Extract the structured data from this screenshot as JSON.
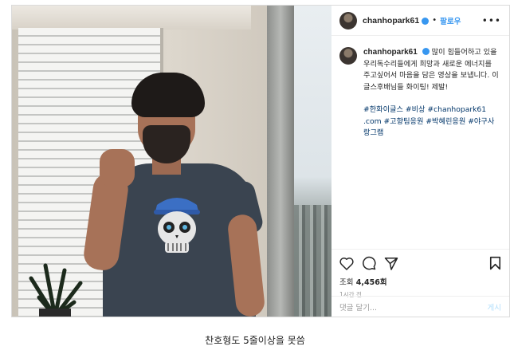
{
  "post": {
    "username": "chanhopark61",
    "follow_label": "팔로우",
    "caption": {
      "username": "chanhopark61",
      "text": "많이 힘들어하고 있을 우리독수리들에게 희망과 새로운 에너지를 주고싶어서 마음을 담은 영상을 보냅니다. 이글스후배님들 화이팅! 제발!",
      "hashtags": "#한화이글스 #비상 #chanhopark61 .com #고향팀응원 #박혜린응원 #야구사랑그램"
    },
    "views_label": "조회",
    "views_count": "4,456회",
    "time_ago": "1시간 전",
    "comment_placeholder": "댓글 달기...",
    "post_button": "게시"
  },
  "bottom_caption": "찬호형도 5줄이상을 못씀",
  "colors": {
    "link": "#3897f0",
    "hashtag": "#003569",
    "border": "#dbdbdb"
  },
  "icons": [
    "more-icon",
    "heart-icon",
    "comment-icon",
    "share-icon",
    "bookmark-icon",
    "verified-icon"
  ]
}
